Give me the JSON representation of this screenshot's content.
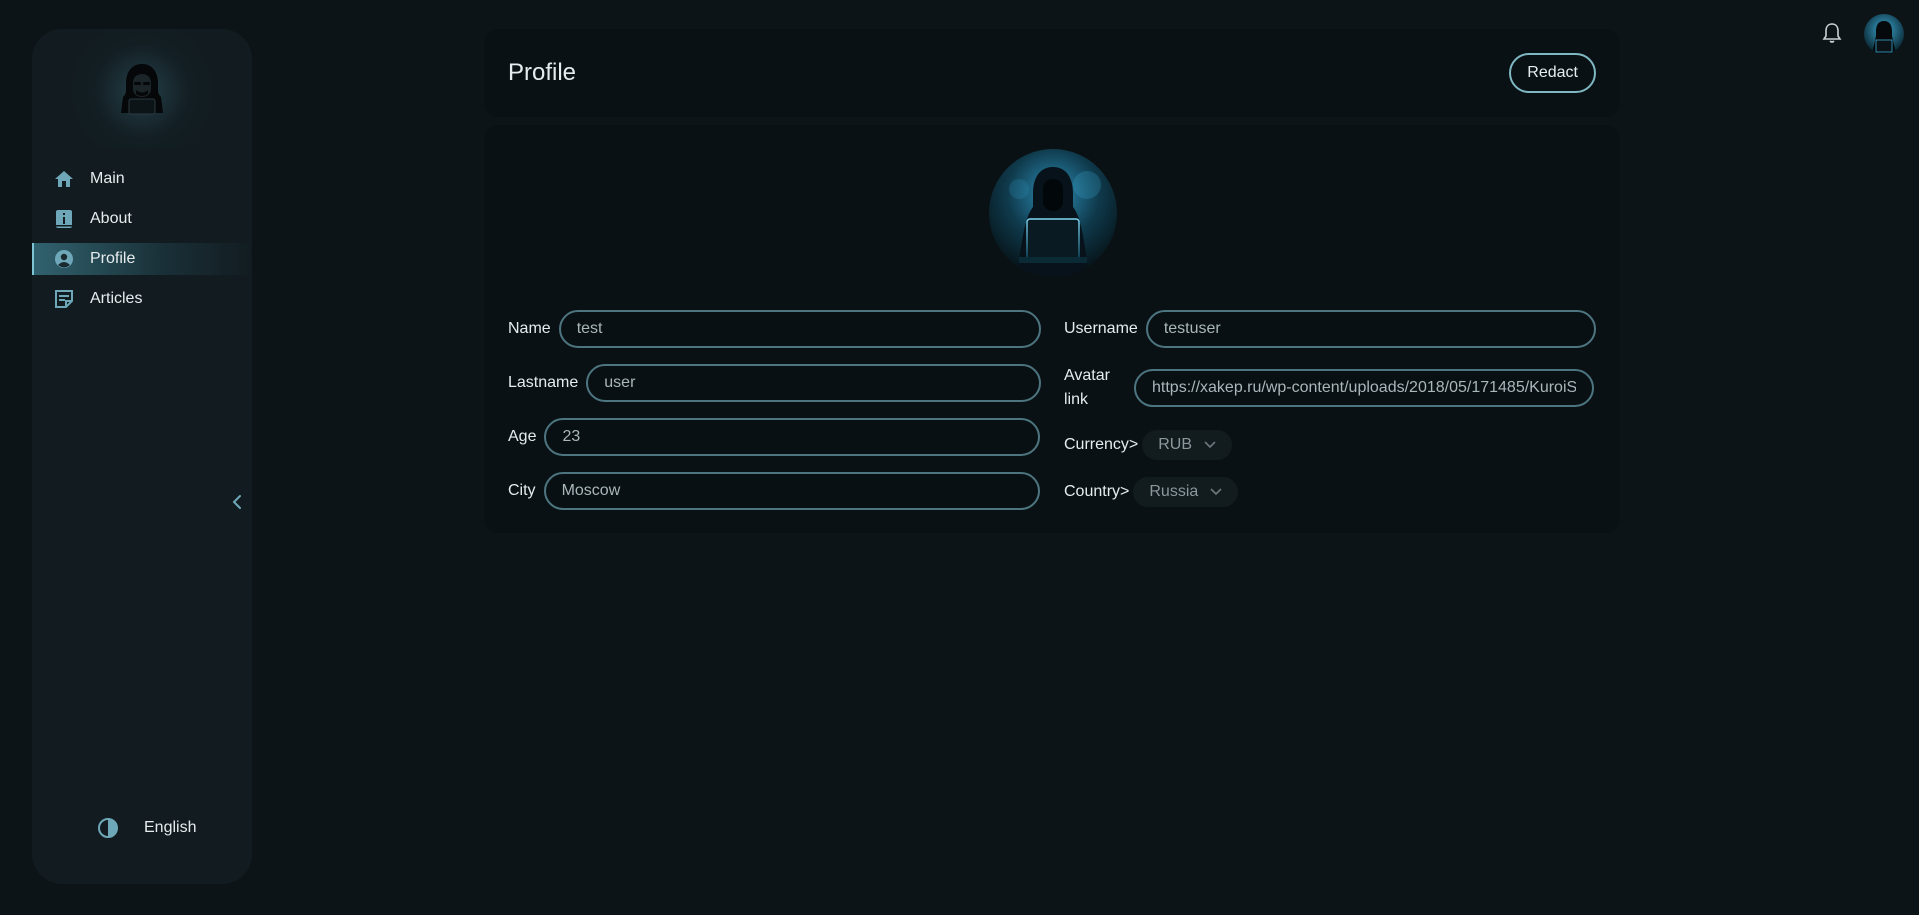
{
  "sidebar": {
    "items": [
      {
        "label": "Main",
        "icon": "home-icon",
        "active": false
      },
      {
        "label": "About",
        "icon": "info-book-icon",
        "active": false
      },
      {
        "label": "Profile",
        "icon": "user-circle-icon",
        "active": true
      },
      {
        "label": "Articles",
        "icon": "article-icon",
        "active": false
      }
    ],
    "language": "English"
  },
  "header": {
    "title": "Profile",
    "redact_label": "Redact"
  },
  "profile": {
    "name_label": "Name",
    "name_value": "test",
    "lastname_label": "Lastname",
    "lastname_value": "user",
    "age_label": "Age",
    "age_value": "23",
    "city_label": "City",
    "city_value": "Moscow",
    "username_label": "Username",
    "username_value": "testuser",
    "avatar_label": "Avatar link",
    "avatar_label_line1": "Avatar",
    "avatar_label_line2": "link",
    "avatar_value": "https://xakep.ru/wp-content/uploads/2018/05/171485/KuroiS",
    "currency_label": "Currency>",
    "currency_value": "RUB",
    "country_label": "Country>",
    "country_value": "Russia"
  },
  "colors": {
    "background": "#0c1417",
    "sidebar": "#121c20",
    "card": "#0a1114",
    "accent": "#7fc4d4",
    "input_border": "#4d7580",
    "icon": "#6ea8b8"
  }
}
